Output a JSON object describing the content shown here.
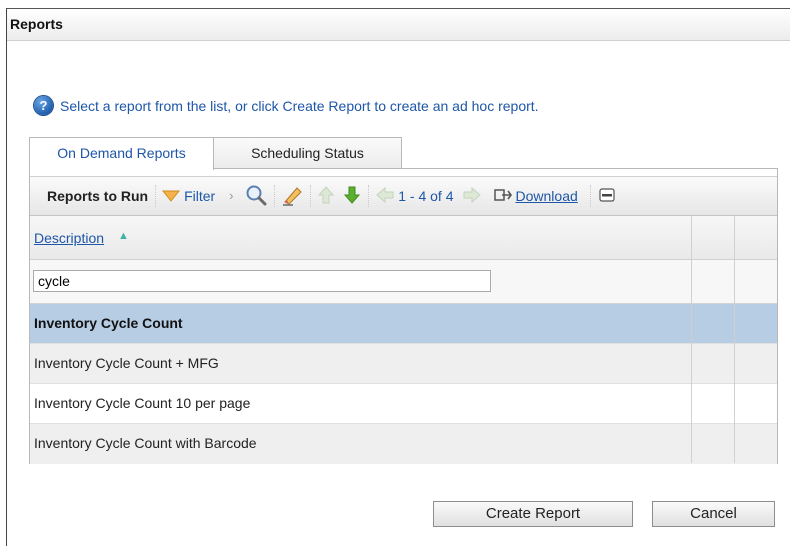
{
  "window": {
    "title": "Reports"
  },
  "info": {
    "icon": "help-icon",
    "text": "Select a report from the list, or click Create Report to create an ad hoc report."
  },
  "tabs": [
    {
      "label": "On Demand Reports",
      "active": true
    },
    {
      "label": "Scheduling Status",
      "active": false
    }
  ],
  "toolbar": {
    "title": "Reports to Run",
    "filter_label": "Filter",
    "pager": "1 - 4 of 4",
    "download_label": "Download"
  },
  "grid": {
    "column_header": "Description",
    "filter_value": "cycle",
    "rows": [
      {
        "description": "Inventory Cycle Count",
        "selected": true
      },
      {
        "description": "Inventory Cycle Count + MFG",
        "selected": false
      },
      {
        "description": "Inventory Cycle Count 10 per page",
        "selected": false
      },
      {
        "description": "Inventory Cycle Count with Barcode",
        "selected": false
      }
    ]
  },
  "buttons": {
    "create": "Create Report",
    "cancel": "Cancel"
  },
  "colors": {
    "link": "#1e56a8",
    "selected_row": "#b6cde4",
    "filter_icon": "#f0a030",
    "down_arrow": "#5cb030"
  }
}
